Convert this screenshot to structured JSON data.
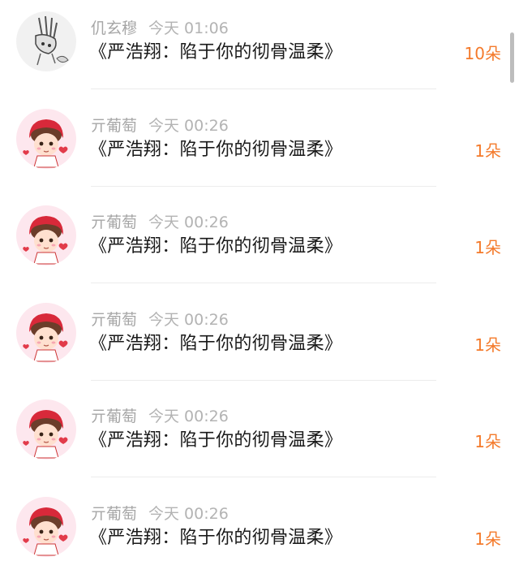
{
  "items": [
    {
      "name": "仉玄穆",
      "time": "今天 01:06",
      "title": "《严浩翔：陷于你的彻骨温柔》",
      "count": "10朵",
      "avatar": "sketch-hand-avatar"
    },
    {
      "name": "亓葡萄",
      "time": "今天 00:26",
      "title": "《严浩翔：陷于你的彻骨温柔》",
      "count": "1朵",
      "avatar": "cartoon-boy-avatar"
    },
    {
      "name": "亓葡萄",
      "time": "今天 00:26",
      "title": "《严浩翔：陷于你的彻骨温柔》",
      "count": "1朵",
      "avatar": "cartoon-boy-avatar"
    },
    {
      "name": "亓葡萄",
      "time": "今天 00:26",
      "title": "《严浩翔：陷于你的彻骨温柔》",
      "count": "1朵",
      "avatar": "cartoon-boy-avatar"
    },
    {
      "name": "亓葡萄",
      "time": "今天 00:26",
      "title": "《严浩翔：陷于你的彻骨温柔》",
      "count": "1朵",
      "avatar": "cartoon-boy-avatar"
    },
    {
      "name": "亓葡萄",
      "time": "今天 00:26",
      "title": "《严浩翔：陷于你的彻骨温柔》",
      "count": "1朵",
      "avatar": "cartoon-boy-avatar"
    }
  ],
  "colors": {
    "accent": "#f47a2b",
    "meta_text": "#a8a8a8",
    "title_text": "#1a1a1a",
    "avatar_bg": "#fde7ee"
  }
}
